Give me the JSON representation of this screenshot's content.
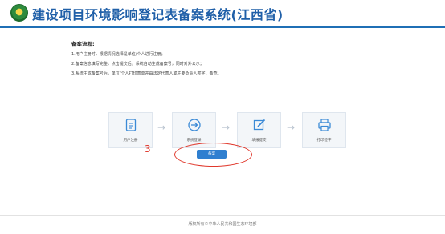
{
  "header": {
    "title": "建设项目环境影响登记表备案系统(江西省)"
  },
  "process": {
    "title": "备案流程:",
    "steps": [
      "1.用户注册时，根据情况选择是单位/个人进行注册；",
      "2.备案信息填写完整，点击提交后，系统自动生成备案号，同时对外公示；",
      "3.系统生成备案号后，单位/个人打印表单并由法定代表人或主要负责人签字，备查。"
    ]
  },
  "flow": {
    "items": [
      {
        "label": "用户注册",
        "icon": "document-icon"
      },
      {
        "label": "系统登录",
        "icon": "login-arrow-icon"
      },
      {
        "label": "填报提交",
        "icon": "edit-icon"
      },
      {
        "label": "打印签字",
        "icon": "printer-icon"
      }
    ],
    "arrow": "→"
  },
  "annotation": {
    "number": "3",
    "color": "#e0382c"
  },
  "actions": {
    "submit_label": "备案"
  },
  "footer": {
    "text": "版权所有©中华人民共和国生态环境部"
  },
  "colors": {
    "brand_blue": "#1f5fa8",
    "button_blue": "#2f7fd0",
    "icon_blue": "#3b8ad6"
  }
}
